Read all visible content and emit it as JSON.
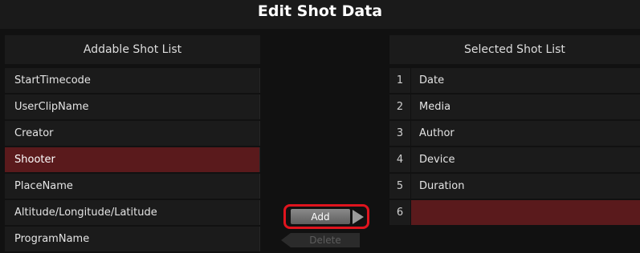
{
  "title": "Edit Shot Data",
  "addable": {
    "header": "Addable Shot List",
    "items": [
      "StartTimecode",
      "UserClipName",
      "Creator",
      "Shooter",
      "PlaceName",
      "Altitude/Longitude/Latitude",
      "ProgramName"
    ],
    "selected_item": "Shooter"
  },
  "selected": {
    "header": "Selected Shot List",
    "items": [
      {
        "num": "1",
        "name": "Date"
      },
      {
        "num": "2",
        "name": "Media"
      },
      {
        "num": "3",
        "name": "Author"
      },
      {
        "num": "4",
        "name": "Device"
      },
      {
        "num": "5",
        "name": "Duration"
      },
      {
        "num": "6",
        "name": ""
      }
    ]
  },
  "buttons": {
    "add_label": "Add",
    "delete_label": "Delete"
  },
  "colors": {
    "highlight": "#5a1a1c",
    "callout": "#e0141e"
  }
}
